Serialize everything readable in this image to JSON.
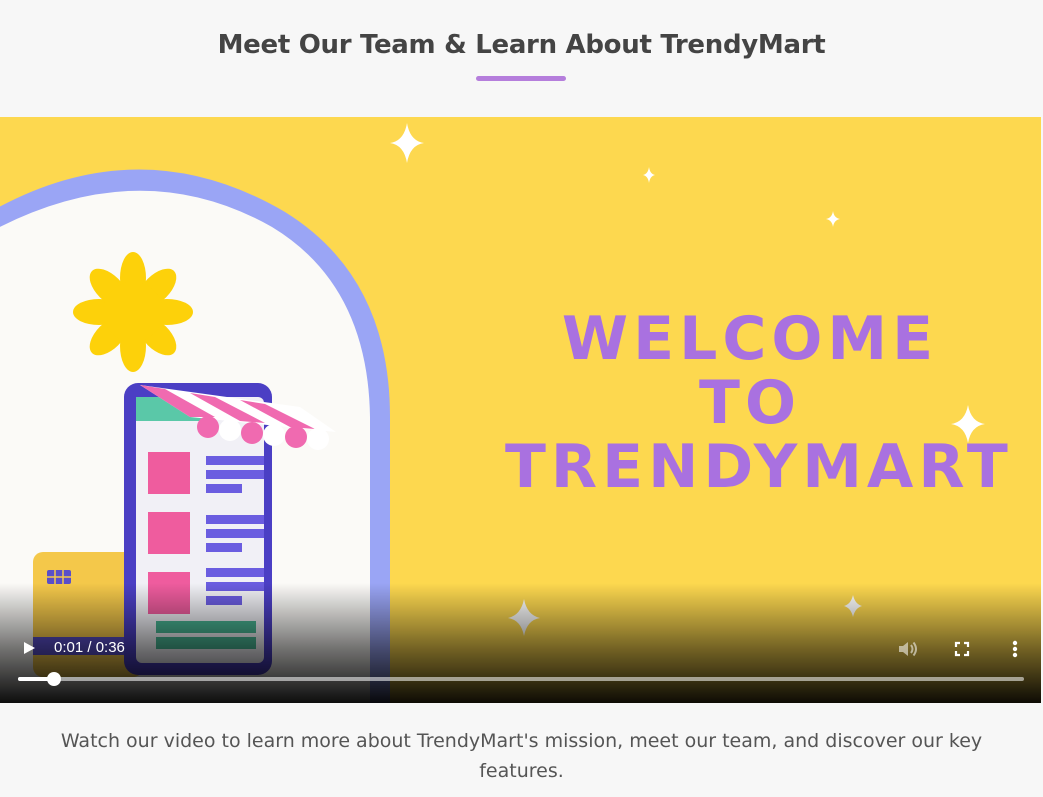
{
  "header": {
    "title": "Meet Our Team & Learn About TrendyMart",
    "accent_color": "#b57edc"
  },
  "video": {
    "headline_lines": [
      "WELCOME",
      "TO",
      "TRENDYMART"
    ],
    "headline_color": "#a971e0",
    "background_color": "#fdd84f",
    "time_display": "0:01 / 0:36",
    "progress_fraction": 0.036,
    "icons": {
      "play": "play-icon",
      "volume": "volume-icon",
      "fullscreen": "fullscreen-icon",
      "more": "more-vertical-icon"
    }
  },
  "caption": "Watch our video to learn more about TrendyMart's mission, meet our team, and discover our key features."
}
